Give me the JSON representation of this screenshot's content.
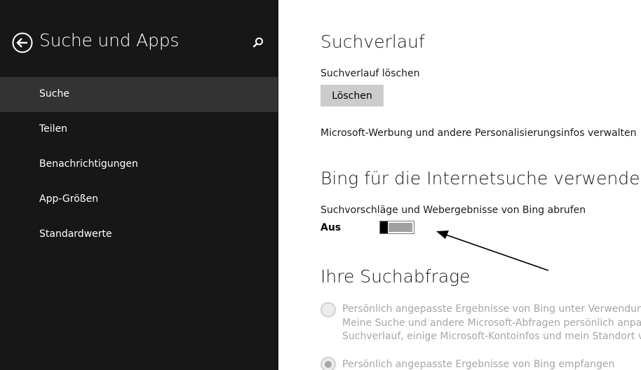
{
  "sidebar": {
    "title": "Suche und Apps",
    "items": [
      {
        "label": "Suche",
        "selected": true
      },
      {
        "label": "Teilen",
        "selected": false
      },
      {
        "label": "Benachrichtigungen",
        "selected": false
      },
      {
        "label": "App-Größen",
        "selected": false
      },
      {
        "label": "Standardwerte",
        "selected": false
      }
    ]
  },
  "main": {
    "history": {
      "heading": "Suchverlauf",
      "clear_label": "Suchverlauf löschen",
      "clear_button": "Löschen",
      "ads_link": "Microsoft-Werbung und andere Personalisierungsinfos verwalten"
    },
    "bing": {
      "heading": "Bing für die Internetsuche verwenden",
      "setting_label": "Suchvorschläge und Webergebnisse von Bing abrufen",
      "toggle_state": "Aus",
      "toggle_on": false
    },
    "query": {
      "heading": "Ihre Suchabfrage",
      "option1": {
        "lines": [
          "Persönlich angepasste Ergebnisse von Bing unter Verwendung me",
          "Meine Suche und andere Microsoft-Abfragen persönlich anpassen",
          "Suchverlauf, einige Microsoft-Kontoinfos und mein Standort verwe"
        ],
        "selected": false
      },
      "option2": {
        "label": "Persönlich angepasste Ergebnisse von Bing empfangen",
        "selected": true
      }
    }
  },
  "colors": {
    "sidebar_bg": "#171717",
    "selected_bg": "#333333",
    "button_bg": "#cccccc",
    "disabled_text": "#a6a6a6"
  }
}
